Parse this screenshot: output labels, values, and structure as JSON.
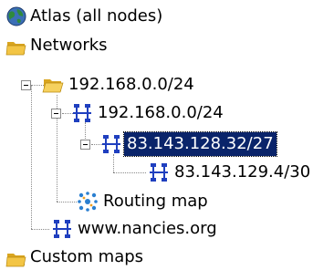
{
  "tree": {
    "nodes": [
      {
        "id": "atlas",
        "label": "Atlas (all nodes)",
        "icon": "globe-icon"
      },
      {
        "id": "networks",
        "label": "Networks",
        "icon": "folder-icon"
      },
      {
        "id": "net-192-folder",
        "label": "192.168.0.0/24",
        "icon": "folder-icon",
        "expanded": true
      },
      {
        "id": "net-192",
        "label": "192.168.0.0/24",
        "icon": "network-icon",
        "expanded": true
      },
      {
        "id": "net-83-32",
        "label": "83.143.128.32/27",
        "icon": "network-icon",
        "expanded": true,
        "selected": true
      },
      {
        "id": "net-83-4",
        "label": "83.143.129.4/30",
        "icon": "network-icon"
      },
      {
        "id": "routing-map",
        "label": "Routing map",
        "icon": "routing-map-icon"
      },
      {
        "id": "nancies",
        "label": "www.nancies.org",
        "icon": "network-icon"
      },
      {
        "id": "custom-maps",
        "label": "Custom maps",
        "icon": "folder-icon"
      }
    ]
  },
  "colors": {
    "selection_bg": "#0a246a",
    "selection_fg": "#ffffff",
    "network_icon": "#1f3fbf",
    "folder": "#f3c545"
  }
}
